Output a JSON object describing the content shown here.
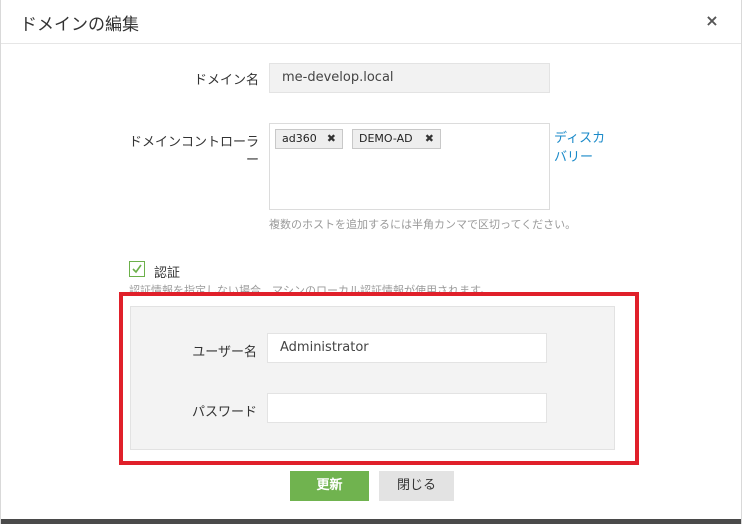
{
  "dialog": {
    "title": "ドメインの編集",
    "close_symbol": "×"
  },
  "domain": {
    "label": "ドメイン名",
    "value": "me-develop.local"
  },
  "controller": {
    "label_line1": "ドメインコントローラ",
    "label_line2": "ー",
    "tags": [
      {
        "text": "ad360",
        "remove": "✖"
      },
      {
        "text": "DEMO-AD",
        "remove": "✖"
      }
    ],
    "discovery_line1": "ディスカ",
    "discovery_line2": "バリー",
    "hint": "複数のホストを追加するには半角カンマで区切ってください。"
  },
  "auth": {
    "checked": true,
    "label": "認証",
    "hint": "認証情報を指定しない場合、マシンのローカル認証情報が使用されます。"
  },
  "credentials": {
    "username_label": "ユーザー名",
    "username_value": "Administrator",
    "password_label": "パスワード",
    "password_value": ""
  },
  "buttons": {
    "update": "更新",
    "close": "閉じる"
  },
  "colors": {
    "highlight": "#e0202a",
    "primary": "#70b34f",
    "link": "#1a8ac9"
  }
}
